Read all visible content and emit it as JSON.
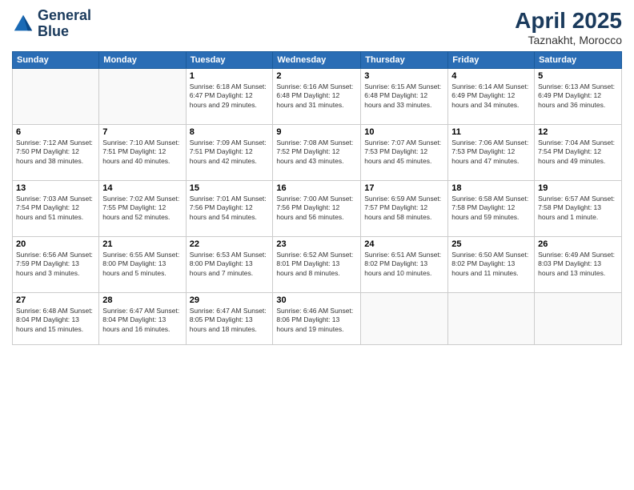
{
  "header": {
    "logo_line1": "General",
    "logo_line2": "Blue",
    "month": "April 2025",
    "location": "Taznakht, Morocco"
  },
  "weekdays": [
    "Sunday",
    "Monday",
    "Tuesday",
    "Wednesday",
    "Thursday",
    "Friday",
    "Saturday"
  ],
  "weeks": [
    [
      {
        "day": "",
        "info": ""
      },
      {
        "day": "",
        "info": ""
      },
      {
        "day": "1",
        "info": "Sunrise: 6:18 AM\nSunset: 6:47 PM\nDaylight: 12 hours\nand 29 minutes."
      },
      {
        "day": "2",
        "info": "Sunrise: 6:16 AM\nSunset: 6:48 PM\nDaylight: 12 hours\nand 31 minutes."
      },
      {
        "day": "3",
        "info": "Sunrise: 6:15 AM\nSunset: 6:48 PM\nDaylight: 12 hours\nand 33 minutes."
      },
      {
        "day": "4",
        "info": "Sunrise: 6:14 AM\nSunset: 6:49 PM\nDaylight: 12 hours\nand 34 minutes."
      },
      {
        "day": "5",
        "info": "Sunrise: 6:13 AM\nSunset: 6:49 PM\nDaylight: 12 hours\nand 36 minutes."
      }
    ],
    [
      {
        "day": "6",
        "info": "Sunrise: 7:12 AM\nSunset: 7:50 PM\nDaylight: 12 hours\nand 38 minutes."
      },
      {
        "day": "7",
        "info": "Sunrise: 7:10 AM\nSunset: 7:51 PM\nDaylight: 12 hours\nand 40 minutes."
      },
      {
        "day": "8",
        "info": "Sunrise: 7:09 AM\nSunset: 7:51 PM\nDaylight: 12 hours\nand 42 minutes."
      },
      {
        "day": "9",
        "info": "Sunrise: 7:08 AM\nSunset: 7:52 PM\nDaylight: 12 hours\nand 43 minutes."
      },
      {
        "day": "10",
        "info": "Sunrise: 7:07 AM\nSunset: 7:53 PM\nDaylight: 12 hours\nand 45 minutes."
      },
      {
        "day": "11",
        "info": "Sunrise: 7:06 AM\nSunset: 7:53 PM\nDaylight: 12 hours\nand 47 minutes."
      },
      {
        "day": "12",
        "info": "Sunrise: 7:04 AM\nSunset: 7:54 PM\nDaylight: 12 hours\nand 49 minutes."
      }
    ],
    [
      {
        "day": "13",
        "info": "Sunrise: 7:03 AM\nSunset: 7:54 PM\nDaylight: 12 hours\nand 51 minutes."
      },
      {
        "day": "14",
        "info": "Sunrise: 7:02 AM\nSunset: 7:55 PM\nDaylight: 12 hours\nand 52 minutes."
      },
      {
        "day": "15",
        "info": "Sunrise: 7:01 AM\nSunset: 7:56 PM\nDaylight: 12 hours\nand 54 minutes."
      },
      {
        "day": "16",
        "info": "Sunrise: 7:00 AM\nSunset: 7:56 PM\nDaylight: 12 hours\nand 56 minutes."
      },
      {
        "day": "17",
        "info": "Sunrise: 6:59 AM\nSunset: 7:57 PM\nDaylight: 12 hours\nand 58 minutes."
      },
      {
        "day": "18",
        "info": "Sunrise: 6:58 AM\nSunset: 7:58 PM\nDaylight: 12 hours\nand 59 minutes."
      },
      {
        "day": "19",
        "info": "Sunrise: 6:57 AM\nSunset: 7:58 PM\nDaylight: 13 hours\nand 1 minute."
      }
    ],
    [
      {
        "day": "20",
        "info": "Sunrise: 6:56 AM\nSunset: 7:59 PM\nDaylight: 13 hours\nand 3 minutes."
      },
      {
        "day": "21",
        "info": "Sunrise: 6:55 AM\nSunset: 8:00 PM\nDaylight: 13 hours\nand 5 minutes."
      },
      {
        "day": "22",
        "info": "Sunrise: 6:53 AM\nSunset: 8:00 PM\nDaylight: 13 hours\nand 7 minutes."
      },
      {
        "day": "23",
        "info": "Sunrise: 6:52 AM\nSunset: 8:01 PM\nDaylight: 13 hours\nand 8 minutes."
      },
      {
        "day": "24",
        "info": "Sunrise: 6:51 AM\nSunset: 8:02 PM\nDaylight: 13 hours\nand 10 minutes."
      },
      {
        "day": "25",
        "info": "Sunrise: 6:50 AM\nSunset: 8:02 PM\nDaylight: 13 hours\nand 11 minutes."
      },
      {
        "day": "26",
        "info": "Sunrise: 6:49 AM\nSunset: 8:03 PM\nDaylight: 13 hours\nand 13 minutes."
      }
    ],
    [
      {
        "day": "27",
        "info": "Sunrise: 6:48 AM\nSunset: 8:04 PM\nDaylight: 13 hours\nand 15 minutes."
      },
      {
        "day": "28",
        "info": "Sunrise: 6:47 AM\nSunset: 8:04 PM\nDaylight: 13 hours\nand 16 minutes."
      },
      {
        "day": "29",
        "info": "Sunrise: 6:47 AM\nSunset: 8:05 PM\nDaylight: 13 hours\nand 18 minutes."
      },
      {
        "day": "30",
        "info": "Sunrise: 6:46 AM\nSunset: 8:06 PM\nDaylight: 13 hours\nand 19 minutes."
      },
      {
        "day": "",
        "info": ""
      },
      {
        "day": "",
        "info": ""
      },
      {
        "day": "",
        "info": ""
      }
    ]
  ]
}
